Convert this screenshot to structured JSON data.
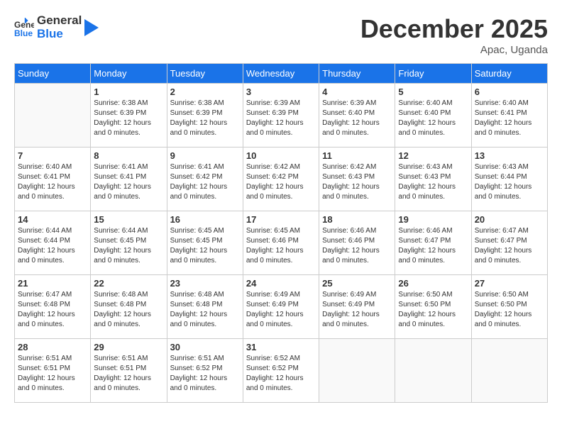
{
  "header": {
    "logo_general": "General",
    "logo_blue": "Blue",
    "title": "December 2025",
    "location": "Apac, Uganda"
  },
  "days_of_week": [
    "Sunday",
    "Monday",
    "Tuesday",
    "Wednesday",
    "Thursday",
    "Friday",
    "Saturday"
  ],
  "weeks": [
    [
      {
        "day": "",
        "sunrise": "",
        "sunset": "",
        "daylight": ""
      },
      {
        "day": "1",
        "sunrise": "Sunrise: 6:38 AM",
        "sunset": "Sunset: 6:39 PM",
        "daylight": "Daylight: 12 hours and 0 minutes."
      },
      {
        "day": "2",
        "sunrise": "Sunrise: 6:38 AM",
        "sunset": "Sunset: 6:39 PM",
        "daylight": "Daylight: 12 hours and 0 minutes."
      },
      {
        "day": "3",
        "sunrise": "Sunrise: 6:39 AM",
        "sunset": "Sunset: 6:39 PM",
        "daylight": "Daylight: 12 hours and 0 minutes."
      },
      {
        "day": "4",
        "sunrise": "Sunrise: 6:39 AM",
        "sunset": "Sunset: 6:40 PM",
        "daylight": "Daylight: 12 hours and 0 minutes."
      },
      {
        "day": "5",
        "sunrise": "Sunrise: 6:40 AM",
        "sunset": "Sunset: 6:40 PM",
        "daylight": "Daylight: 12 hours and 0 minutes."
      },
      {
        "day": "6",
        "sunrise": "Sunrise: 6:40 AM",
        "sunset": "Sunset: 6:41 PM",
        "daylight": "Daylight: 12 hours and 0 minutes."
      }
    ],
    [
      {
        "day": "7",
        "sunrise": "Sunrise: 6:40 AM",
        "sunset": "Sunset: 6:41 PM",
        "daylight": "Daylight: 12 hours and 0 minutes."
      },
      {
        "day": "8",
        "sunrise": "Sunrise: 6:41 AM",
        "sunset": "Sunset: 6:41 PM",
        "daylight": "Daylight: 12 hours and 0 minutes."
      },
      {
        "day": "9",
        "sunrise": "Sunrise: 6:41 AM",
        "sunset": "Sunset: 6:42 PM",
        "daylight": "Daylight: 12 hours and 0 minutes."
      },
      {
        "day": "10",
        "sunrise": "Sunrise: 6:42 AM",
        "sunset": "Sunset: 6:42 PM",
        "daylight": "Daylight: 12 hours and 0 minutes."
      },
      {
        "day": "11",
        "sunrise": "Sunrise: 6:42 AM",
        "sunset": "Sunset: 6:43 PM",
        "daylight": "Daylight: 12 hours and 0 minutes."
      },
      {
        "day": "12",
        "sunrise": "Sunrise: 6:43 AM",
        "sunset": "Sunset: 6:43 PM",
        "daylight": "Daylight: 12 hours and 0 minutes."
      },
      {
        "day": "13",
        "sunrise": "Sunrise: 6:43 AM",
        "sunset": "Sunset: 6:44 PM",
        "daylight": "Daylight: 12 hours and 0 minutes."
      }
    ],
    [
      {
        "day": "14",
        "sunrise": "Sunrise: 6:44 AM",
        "sunset": "Sunset: 6:44 PM",
        "daylight": "Daylight: 12 hours and 0 minutes."
      },
      {
        "day": "15",
        "sunrise": "Sunrise: 6:44 AM",
        "sunset": "Sunset: 6:45 PM",
        "daylight": "Daylight: 12 hours and 0 minutes."
      },
      {
        "day": "16",
        "sunrise": "Sunrise: 6:45 AM",
        "sunset": "Sunset: 6:45 PM",
        "daylight": "Daylight: 12 hours and 0 minutes."
      },
      {
        "day": "17",
        "sunrise": "Sunrise: 6:45 AM",
        "sunset": "Sunset: 6:46 PM",
        "daylight": "Daylight: 12 hours and 0 minutes."
      },
      {
        "day": "18",
        "sunrise": "Sunrise: 6:46 AM",
        "sunset": "Sunset: 6:46 PM",
        "daylight": "Daylight: 12 hours and 0 minutes."
      },
      {
        "day": "19",
        "sunrise": "Sunrise: 6:46 AM",
        "sunset": "Sunset: 6:47 PM",
        "daylight": "Daylight: 12 hours and 0 minutes."
      },
      {
        "day": "20",
        "sunrise": "Sunrise: 6:47 AM",
        "sunset": "Sunset: 6:47 PM",
        "daylight": "Daylight: 12 hours and 0 minutes."
      }
    ],
    [
      {
        "day": "21",
        "sunrise": "Sunrise: 6:47 AM",
        "sunset": "Sunset: 6:48 PM",
        "daylight": "Daylight: 12 hours and 0 minutes."
      },
      {
        "day": "22",
        "sunrise": "Sunrise: 6:48 AM",
        "sunset": "Sunset: 6:48 PM",
        "daylight": "Daylight: 12 hours and 0 minutes."
      },
      {
        "day": "23",
        "sunrise": "Sunrise: 6:48 AM",
        "sunset": "Sunset: 6:48 PM",
        "daylight": "Daylight: 12 hours and 0 minutes."
      },
      {
        "day": "24",
        "sunrise": "Sunrise: 6:49 AM",
        "sunset": "Sunset: 6:49 PM",
        "daylight": "Daylight: 12 hours and 0 minutes."
      },
      {
        "day": "25",
        "sunrise": "Sunrise: 6:49 AM",
        "sunset": "Sunset: 6:49 PM",
        "daylight": "Daylight: 12 hours and 0 minutes."
      },
      {
        "day": "26",
        "sunrise": "Sunrise: 6:50 AM",
        "sunset": "Sunset: 6:50 PM",
        "daylight": "Daylight: 12 hours and 0 minutes."
      },
      {
        "day": "27",
        "sunrise": "Sunrise: 6:50 AM",
        "sunset": "Sunset: 6:50 PM",
        "daylight": "Daylight: 12 hours and 0 minutes."
      }
    ],
    [
      {
        "day": "28",
        "sunrise": "Sunrise: 6:51 AM",
        "sunset": "Sunset: 6:51 PM",
        "daylight": "Daylight: 12 hours and 0 minutes."
      },
      {
        "day": "29",
        "sunrise": "Sunrise: 6:51 AM",
        "sunset": "Sunset: 6:51 PM",
        "daylight": "Daylight: 12 hours and 0 minutes."
      },
      {
        "day": "30",
        "sunrise": "Sunrise: 6:51 AM",
        "sunset": "Sunset: 6:52 PM",
        "daylight": "Daylight: 12 hours and 0 minutes."
      },
      {
        "day": "31",
        "sunrise": "Sunrise: 6:52 AM",
        "sunset": "Sunset: 6:52 PM",
        "daylight": "Daylight: 12 hours and 0 minutes."
      },
      {
        "day": "",
        "sunrise": "",
        "sunset": "",
        "daylight": ""
      },
      {
        "day": "",
        "sunrise": "",
        "sunset": "",
        "daylight": ""
      },
      {
        "day": "",
        "sunrise": "",
        "sunset": "",
        "daylight": ""
      }
    ]
  ]
}
